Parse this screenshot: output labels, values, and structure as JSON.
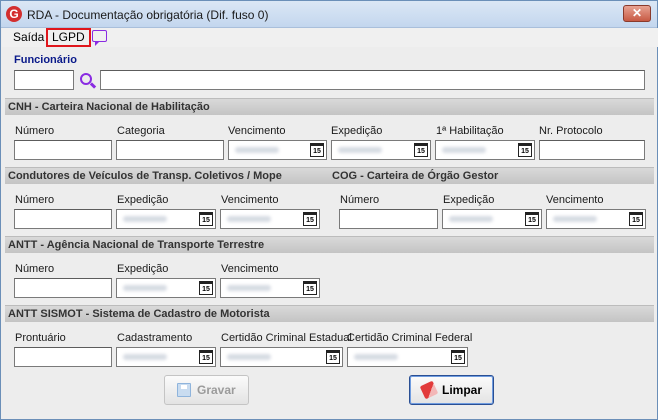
{
  "window": {
    "title": "RDA - Documentação obrigatória (Dif. fuso 0)",
    "logo_letter": "G",
    "close_glyph": "✕"
  },
  "menu": {
    "saida": "Saída",
    "lgpd": "LGPD"
  },
  "funcionario": {
    "label": "Funcionário"
  },
  "calendar_icon_text": "15",
  "sections": {
    "cnh": {
      "title": "CNH - Carteira Nacional de Habilitação",
      "labels": {
        "numero": "Número",
        "categoria": "Categoria",
        "vencimento": "Vencimento",
        "expedicao": "Expedição",
        "primeira_habilitacao": "1ª Habilitação",
        "protocolo": "Nr. Protocolo"
      }
    },
    "mope": {
      "title": "Condutores de Veículos de Transp. Coletivos / Mope",
      "labels": {
        "numero": "Número",
        "expedicao": "Expedição",
        "vencimento": "Vencimento"
      }
    },
    "cog": {
      "title": "COG - Carteira de Órgão Gestor",
      "labels": {
        "numero": "Número",
        "expedicao": "Expedição",
        "vencimento": "Vencimento"
      }
    },
    "antt": {
      "title": "ANTT - Agência Nacional de Transporte Terrestre",
      "labels": {
        "numero": "Número",
        "expedicao": "Expedição",
        "vencimento": "Vencimento"
      }
    },
    "sismot": {
      "title": "ANTT SISMOT - Sistema de Cadastro de Motorista",
      "labels": {
        "prontuario": "Prontuário",
        "cadastramento": "Cadastramento",
        "certidao_estadual": "Certidão Criminal Estadual",
        "certidao_federal": "Certidão Criminal Federal"
      }
    }
  },
  "buttons": {
    "gravar": "Gravar",
    "limpar": "Limpar"
  }
}
